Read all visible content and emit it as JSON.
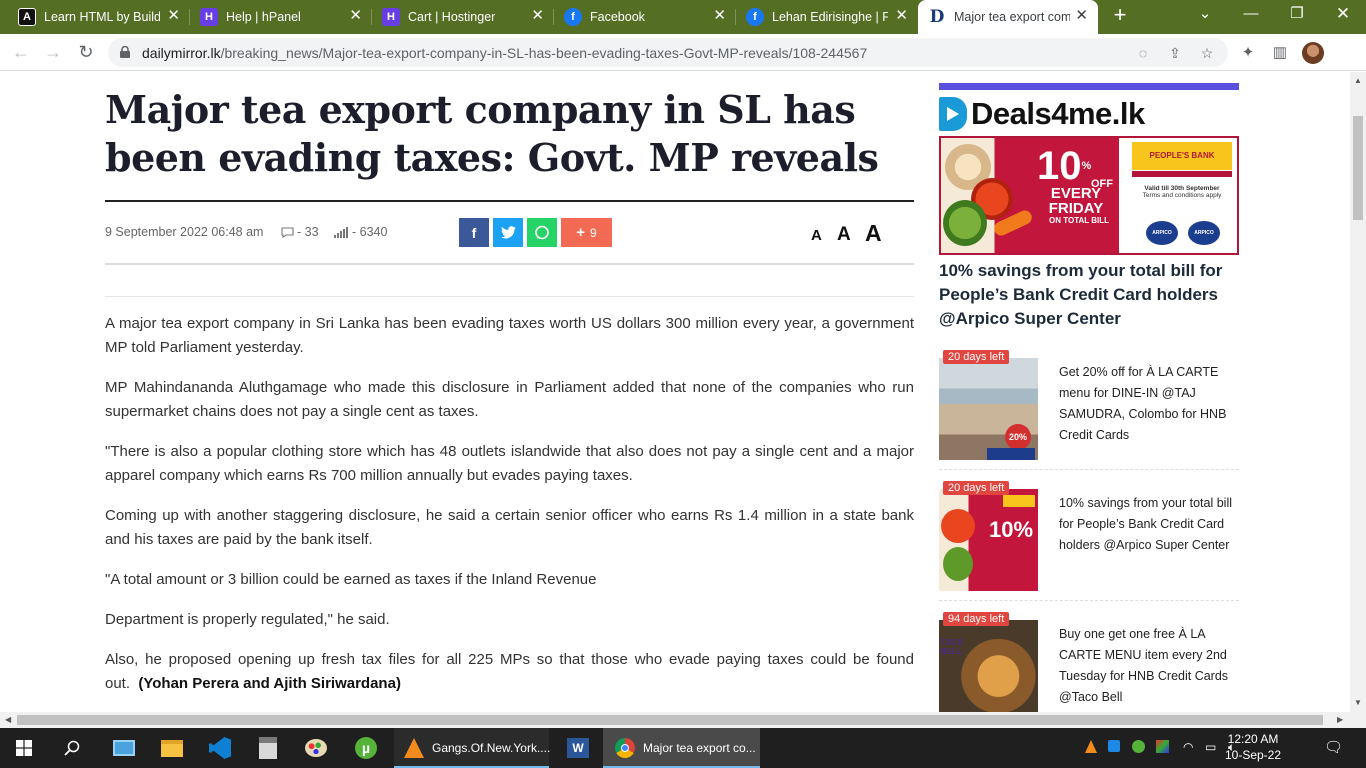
{
  "browser": {
    "tabs": [
      {
        "title": "Learn HTML by Building",
        "favicon": "A"
      },
      {
        "title": "Help | hPanel",
        "favicon": "H"
      },
      {
        "title": "Cart | Hostinger",
        "favicon": "H"
      },
      {
        "title": "Facebook",
        "favicon": "f"
      },
      {
        "title": "Lehan Edirisinghe | Fa",
        "favicon": "f"
      },
      {
        "title": "Major tea export com",
        "favicon": "D"
      }
    ],
    "new_tab": "+",
    "url_host": "dailymirror.lk",
    "url_path": "/breaking_news/Major-tea-export-company-in-SL-has-been-evading-taxes-Govt-MP-reveals/108-244567"
  },
  "article": {
    "headline": "Major tea export company in SL has been evading taxes: Govt. MP reveals",
    "date": "9 September 2022 06:48 am",
    "comments": "- 33",
    "views": "- 6340",
    "share_more_count": "9",
    "font_small": "A",
    "font_medium": "A",
    "font_large": "A",
    "paragraphs": [
      "A major tea export company in Sri Lanka has been evading taxes worth US dollars 300 million every year, a government MP told Parliament yesterday.",
      "MP Mahindananda Aluthgamage who made this disclosure in Parliament added that none of the companies who run supermarket chains does not pay a single cent as taxes.",
      "\"There is also a popular clothing store which has 48 outlets islandwide that also does not pay a single cent and a major apparel company which earns Rs 700 million annually but evades paying taxes.",
      "Coming up with another staggering disclosure, he said a certain senior officer who earns Rs 1.4 million in a state bank and his taxes are paid by the bank itself.",
      "\"A total amount or 3 billion could be earned as taxes if the Inland Revenue",
      "Department is properly regulated,\" he said.",
      "Also, he proposed opening up fresh tax files for all 225 MPs so that those who evade paying taxes could be found out."
    ],
    "byline": "(Yohan Perera and Ajith Siriwardana)"
  },
  "sidebar": {
    "logo": "Deals4me.lk",
    "banner": {
      "percent": "10",
      "percent_suffix": "%",
      "off": "OFF",
      "line1": "EVERY",
      "line2": "FRIDAY",
      "line3": "ON TOTAL BILL",
      "bank": "PEOPLE'S BANK",
      "bank_tag": "Pride of the Nation",
      "valid": "Valid till 30th September",
      "terms": "Terms and conditions apply",
      "store1": "ARPICO SUPERCENTRE",
      "store2": "ARPICO DAILY"
    },
    "featured_title": "10% savings from your total bill for People’s Bank Credit Card holders @Arpico Super Center",
    "offers": [
      {
        "days": "20 days left",
        "text": "Get 20% off for À LA CARTE menu for DINE-IN @TAJ SAMUDRA, Colombo for HNB Credit Cards",
        "badge": "20%"
      },
      {
        "days": "20 days left",
        "text": "10% savings from your total bill for People’s Bank Credit Card holders @Arpico Super Center",
        "badge": "10%"
      },
      {
        "days": "94 days left",
        "text": "Buy one get one free À LA CARTE MENU item every 2nd Tuesday for HNB Credit Cards @Taco Bell",
        "badge": "TACO BELL"
      }
    ]
  },
  "taskbar": {
    "apps": [
      {
        "label": "Gangs.Of.New.York...."
      },
      {
        "label": "Major tea export co..."
      }
    ],
    "time": "12:20 AM",
    "date": "10-Sep-22"
  },
  "colors": {
    "tabstrip": "#546e24",
    "share_facebook": "#3b5998",
    "share_twitter": "#1da1f2",
    "share_whatsapp": "#25d366",
    "share_more": "#f26a53",
    "deals_bar": "#5b4fe0",
    "days_badge": "#e0463f"
  }
}
